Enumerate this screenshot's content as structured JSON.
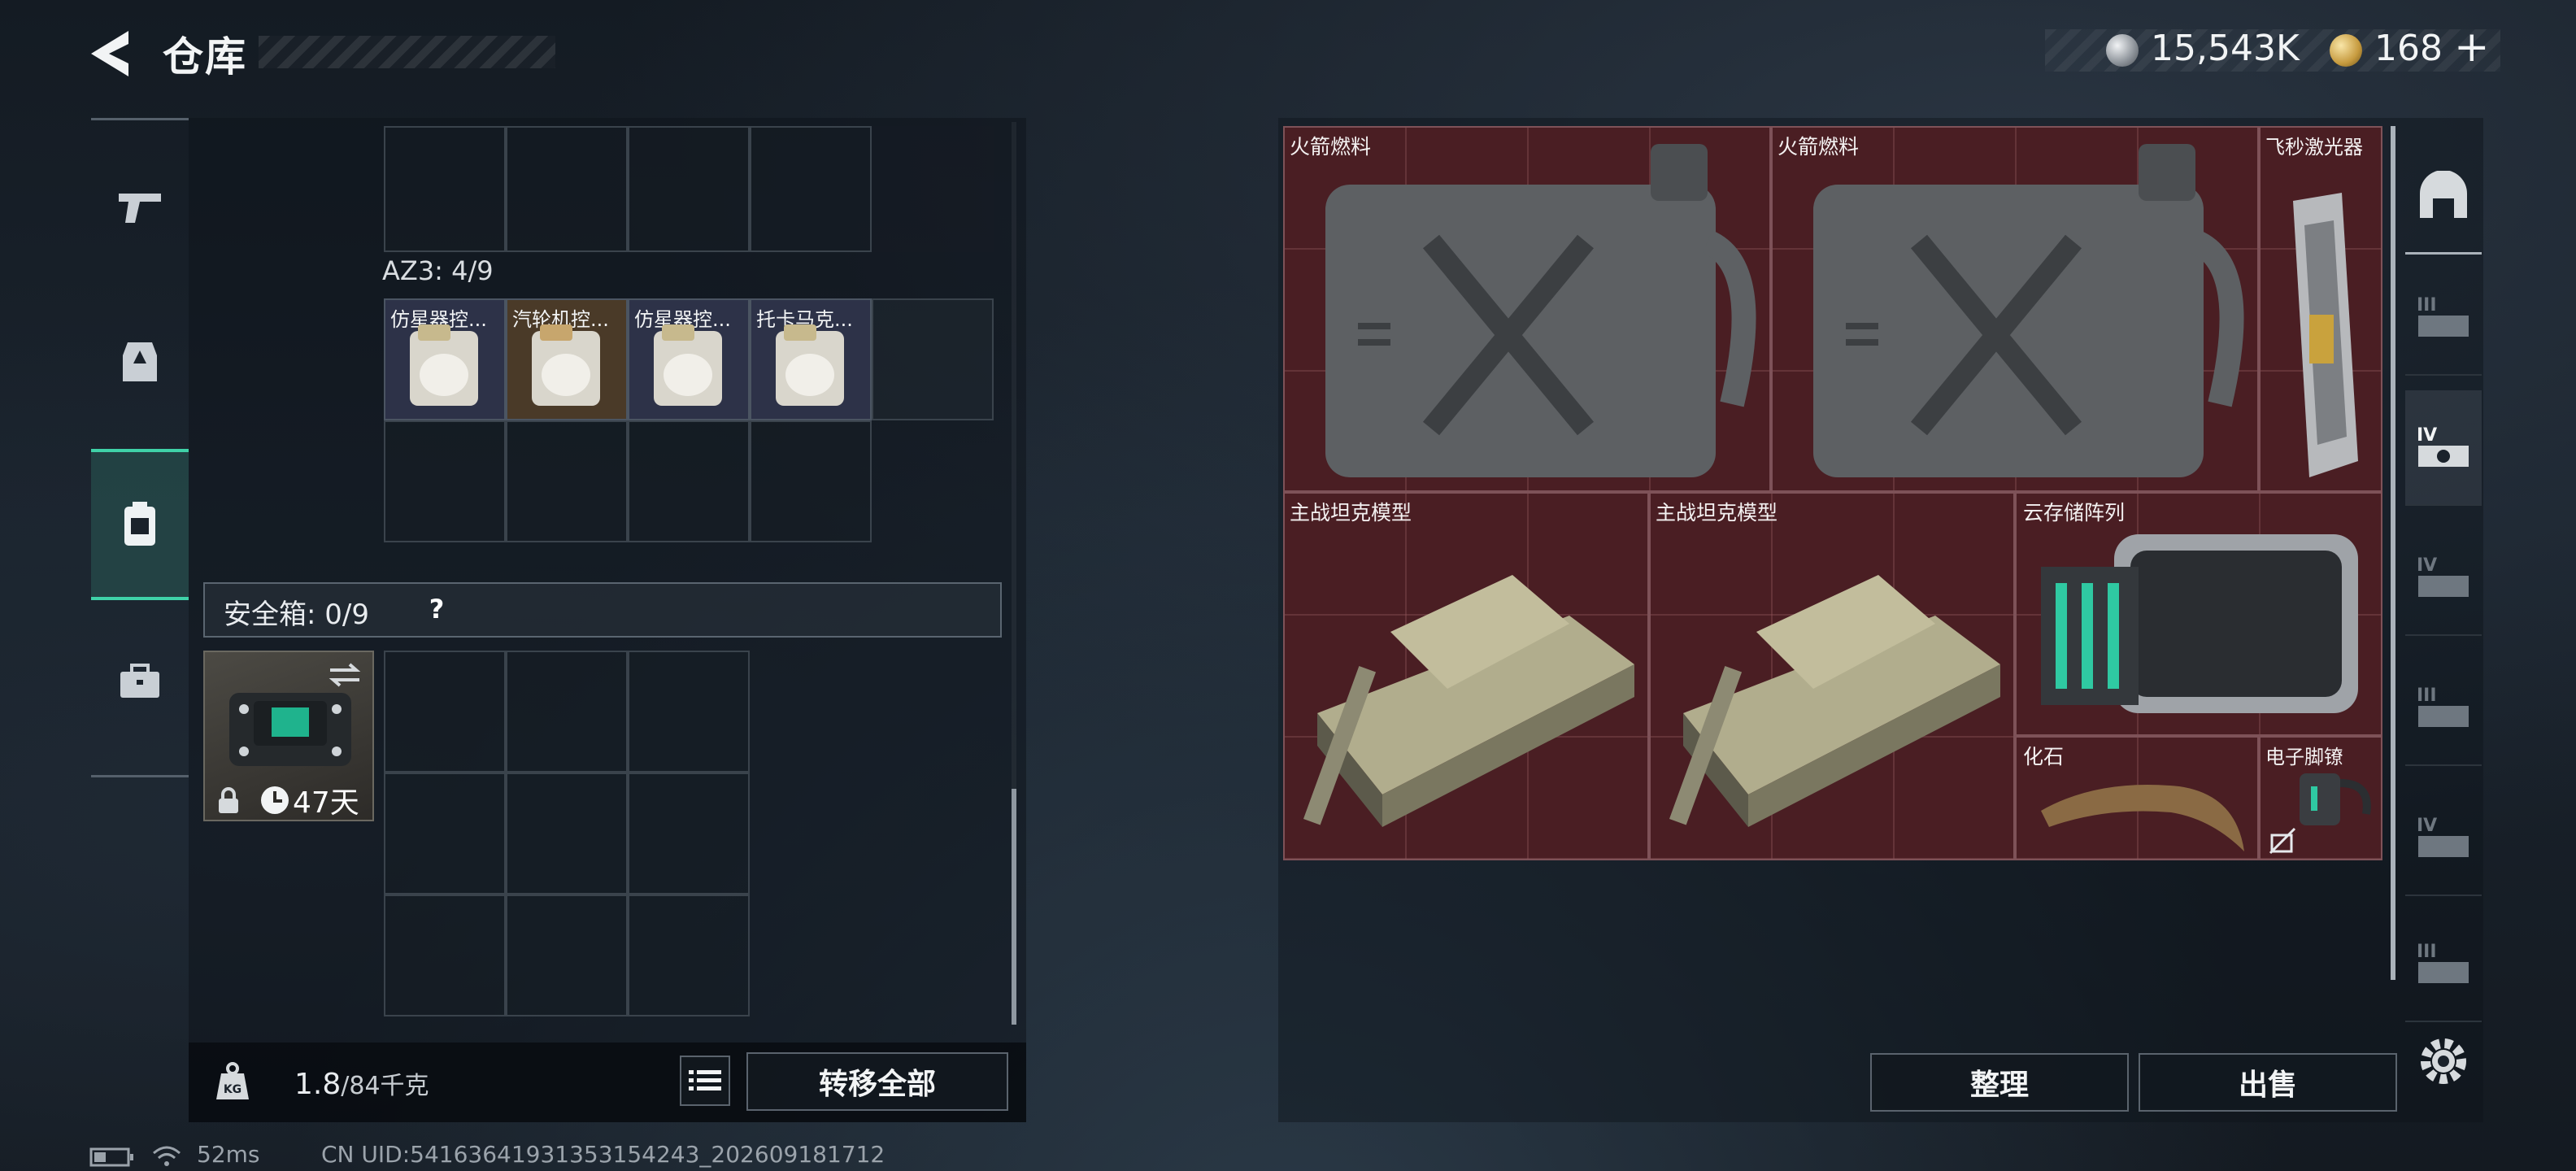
{
  "header": {
    "title": "仓库",
    "currency_silver": "15,543K",
    "currency_gold": "168",
    "add_label": "+"
  },
  "left_rail": {
    "items": [
      {
        "icon": "pistol-icon"
      },
      {
        "icon": "vest-icon"
      },
      {
        "icon": "backpack-icon",
        "active": true
      },
      {
        "icon": "briefcase-icon"
      }
    ]
  },
  "backpack": {
    "az3_label": "AZ3: 4/9",
    "az3_items": [
      {
        "name": "仿星器控..."
      },
      {
        "name": "汽轮机控..."
      },
      {
        "name": "仿星器控..."
      },
      {
        "name": "托卡马克..."
      }
    ]
  },
  "safebox": {
    "label": "安全箱: 0/9",
    "help": "?",
    "case_days": "47天"
  },
  "weight": {
    "current": "1.8",
    "max": "/84千克",
    "transfer_label": "转移全部"
  },
  "stash": {
    "items": [
      {
        "name": "火箭燃料"
      },
      {
        "name": "火箭燃料"
      },
      {
        "name": "飞秒激光器"
      },
      {
        "name": "主战坦克模型"
      },
      {
        "name": "主战坦克模型"
      },
      {
        "name": "云存储阵列"
      },
      {
        "name": "化石"
      },
      {
        "name": "电子脚镣"
      }
    ],
    "sort_label": "整理",
    "sell_label": "出售"
  },
  "footer": {
    "ping": "52ms",
    "uid": "CN UID:54163641931353154243_202609181712"
  }
}
